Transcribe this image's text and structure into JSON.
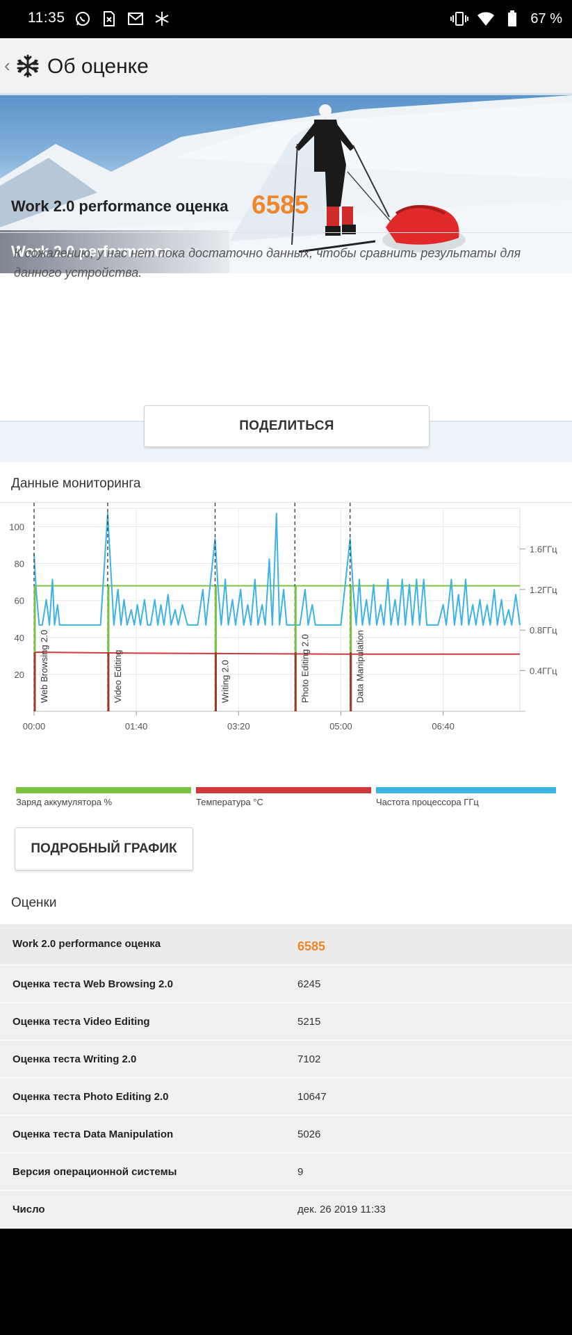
{
  "status_bar": {
    "time": "11:35",
    "battery": "67 %",
    "left_icons": [
      "whatsapp-icon",
      "sim-icon",
      "gmail-icon",
      "snowflake-icon"
    ],
    "right_icons": [
      "vibrate-icon",
      "wifi-icon",
      "battery-icon"
    ]
  },
  "app_bar": {
    "title": "Об оценке"
  },
  "hero": {
    "title": "Work 2.0 performance",
    "version": "2.0"
  },
  "score": {
    "label": "Work 2.0 performance оценка",
    "value": "6585",
    "note": "К сожалению, у нас нет пока достаточно данных, чтобы сравнить результаты для данного устройства."
  },
  "share_button": "ПОДЕЛИТЬСЯ",
  "monitoring": {
    "title": "Данные мониторинга",
    "legend": [
      {
        "label": "Заряд аккумулятора %",
        "color": "#7cc242"
      },
      {
        "label": "Температура °C",
        "color": "#d0393c"
      },
      {
        "label": "Частота процессора ГГц",
        "color": "#3db3e3"
      }
    ]
  },
  "chart_data": {
    "type": "line",
    "xlabel": "",
    "ylabel": "",
    "x_ticks": [
      "00:00",
      "01:40",
      "03:20",
      "05:00",
      "06:40"
    ],
    "x_tick_minutes": [
      0,
      100,
      200,
      300,
      400
    ],
    "x_range_minutes": [
      0,
      475
    ],
    "y_left_ticks": [
      20,
      40,
      60,
      80,
      100
    ],
    "y_left_range": [
      0,
      110
    ],
    "y_right_ticks": [
      "0.4ГГц",
      "0.8ГГц",
      "1.2ГГц",
      "1.6ГГц"
    ],
    "y_right_values": [
      0.4,
      0.8,
      1.2,
      1.6
    ],
    "y_right_range": [
      0,
      2.0
    ],
    "test_markers": [
      {
        "label": "Web Browsing 2.0",
        "minute": 0
      },
      {
        "label": "Video Editing",
        "minute": 72
      },
      {
        "label": "Writing 2.0",
        "minute": 177
      },
      {
        "label": "Photo Editing 2.0",
        "minute": 255
      },
      {
        "label": "Data Manipulation",
        "minute": 309
      }
    ],
    "series": [
      {
        "name": "Заряд аккумулятора %",
        "color": "#7cc242",
        "values": [
          [
            0,
            68
          ],
          [
            475,
            68
          ]
        ]
      },
      {
        "name": "Температура °C",
        "color": "#d0393c",
        "values": [
          [
            0,
            32
          ],
          [
            100,
            31.5
          ],
          [
            300,
            31
          ],
          [
            475,
            31
          ]
        ]
      },
      {
        "name": "Частота процессора ГГц",
        "color": "#3db3e3",
        "values": [
          [
            0,
            1.55
          ],
          [
            2,
            1.2
          ],
          [
            5,
            0.85
          ],
          [
            8,
            0.85
          ],
          [
            12,
            1.1
          ],
          [
            15,
            0.85
          ],
          [
            18,
            1.3
          ],
          [
            20,
            0.85
          ],
          [
            23,
            1.05
          ],
          [
            25,
            0.85
          ],
          [
            40,
            0.85
          ],
          [
            55,
            0.85
          ],
          [
            65,
            0.85
          ],
          [
            72,
            1.95
          ],
          [
            75,
            1.4
          ],
          [
            78,
            0.85
          ],
          [
            82,
            1.2
          ],
          [
            85,
            0.85
          ],
          [
            88,
            1.1
          ],
          [
            91,
            0.85
          ],
          [
            95,
            1.0
          ],
          [
            98,
            0.85
          ],
          [
            101,
            1.05
          ],
          [
            104,
            0.85
          ],
          [
            108,
            1.1
          ],
          [
            111,
            0.85
          ],
          [
            114,
            0.85
          ],
          [
            118,
            1.1
          ],
          [
            121,
            0.85
          ],
          [
            124,
            1.05
          ],
          [
            127,
            0.85
          ],
          [
            131,
            1.15
          ],
          [
            134,
            0.85
          ],
          [
            138,
            1.0
          ],
          [
            141,
            0.85
          ],
          [
            145,
            1.05
          ],
          [
            150,
            0.85
          ],
          [
            160,
            0.85
          ],
          [
            165,
            1.2
          ],
          [
            168,
            0.85
          ],
          [
            177,
            1.7
          ],
          [
            180,
            1.2
          ],
          [
            183,
            0.85
          ],
          [
            187,
            1.3
          ],
          [
            190,
            0.85
          ],
          [
            194,
            1.1
          ],
          [
            197,
            0.85
          ],
          [
            202,
            1.2
          ],
          [
            205,
            0.85
          ],
          [
            209,
            1.05
          ],
          [
            212,
            0.85
          ],
          [
            216,
            1.3
          ],
          [
            219,
            0.85
          ],
          [
            223,
            1.05
          ],
          [
            226,
            0.85
          ],
          [
            230,
            1.5
          ],
          [
            233,
            0.85
          ],
          [
            237,
            1.95
          ],
          [
            240,
            0.85
          ],
          [
            244,
            1.2
          ],
          [
            247,
            0.85
          ],
          [
            250,
            0.85
          ],
          [
            255,
            0.85
          ],
          [
            260,
            0.85
          ],
          [
            265,
            1.2
          ],
          [
            268,
            0.85
          ],
          [
            272,
            1.05
          ],
          [
            275,
            0.85
          ],
          [
            280,
            0.85
          ],
          [
            290,
            0.85
          ],
          [
            300,
            0.85
          ],
          [
            309,
            1.7
          ],
          [
            312,
            1.2
          ],
          [
            315,
            0.85
          ],
          [
            318,
            1.3
          ],
          [
            321,
            0.85
          ],
          [
            325,
            1.1
          ],
          [
            328,
            0.85
          ],
          [
            332,
            1.25
          ],
          [
            335,
            0.85
          ],
          [
            339,
            1.05
          ],
          [
            342,
            0.85
          ],
          [
            346,
            1.3
          ],
          [
            349,
            0.85
          ],
          [
            353,
            1.1
          ],
          [
            356,
            0.85
          ],
          [
            360,
            1.3
          ],
          [
            363,
            0.85
          ],
          [
            367,
            1.25
          ],
          [
            370,
            0.85
          ],
          [
            374,
            1.3
          ],
          [
            377,
            0.85
          ],
          [
            381,
            1.3
          ],
          [
            384,
            0.85
          ],
          [
            390,
            0.85
          ],
          [
            395,
            0.85
          ],
          [
            400,
            1.05
          ],
          [
            403,
            0.85
          ],
          [
            408,
            1.3
          ],
          [
            411,
            0.85
          ],
          [
            415,
            1.15
          ],
          [
            418,
            0.85
          ],
          [
            422,
            1.3
          ],
          [
            425,
            0.85
          ],
          [
            429,
            1.05
          ],
          [
            432,
            0.85
          ],
          [
            436,
            1.1
          ],
          [
            439,
            0.85
          ],
          [
            443,
            1.05
          ],
          [
            446,
            0.85
          ],
          [
            450,
            1.2
          ],
          [
            453,
            0.85
          ],
          [
            457,
            1.1
          ],
          [
            460,
            0.85
          ],
          [
            464,
            1.0
          ],
          [
            467,
            0.85
          ],
          [
            471,
            1.15
          ],
          [
            475,
            0.85
          ]
        ]
      }
    ]
  },
  "detail_button": "ПОДРОБНЫЙ ГРАФИК",
  "scores_table": {
    "heading": "Оценки",
    "rows": [
      {
        "label": "Work 2.0 performance оценка",
        "value": "6585"
      },
      {
        "label": "Оценка теста Web Browsing 2.0",
        "value": "6245"
      },
      {
        "label": "Оценка теста Video Editing",
        "value": "5215"
      },
      {
        "label": "Оценка теста Writing 2.0",
        "value": "7102"
      },
      {
        "label": "Оценка теста Photo Editing 2.0",
        "value": "10647"
      },
      {
        "label": "Оценка теста Data Manipulation",
        "value": "5026"
      },
      {
        "label": "Версия операционной системы",
        "value": "9"
      },
      {
        "label": "Число",
        "value": "дек. 26 2019 11:33"
      }
    ]
  }
}
